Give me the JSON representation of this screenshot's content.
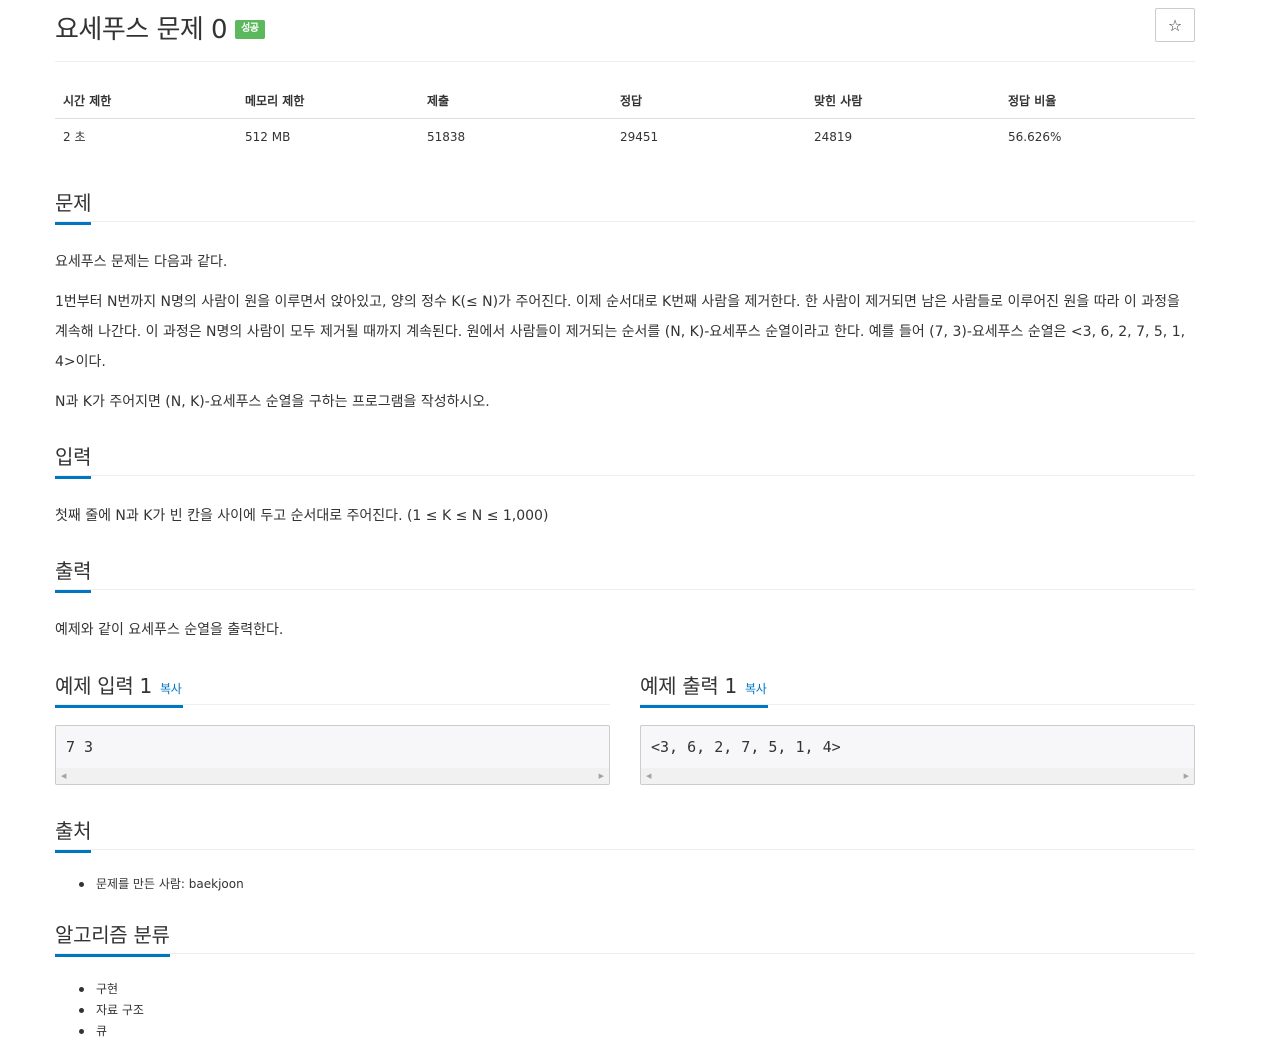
{
  "problem": {
    "title": "요세푸스 문제 0",
    "badge": "성공",
    "star_icon": "☆"
  },
  "stats": {
    "headers": [
      "시간 제한",
      "메모리 제한",
      "제출",
      "정답",
      "맞힌 사람",
      "정답 비율"
    ],
    "values": [
      "2 초",
      "512 MB",
      "51838",
      "29451",
      "24819",
      "56.626%"
    ]
  },
  "sections": {
    "problem": {
      "heading": "문제",
      "paragraphs": [
        "요세푸스 문제는 다음과 같다.",
        "1번부터 N번까지 N명의 사람이 원을 이루면서 앉아있고, 양의 정수 K(≤ N)가 주어진다. 이제 순서대로 K번째 사람을 제거한다. 한 사람이 제거되면 남은 사람들로 이루어진 원을 따라 이 과정을 계속해 나간다. 이 과정은 N명의 사람이 모두 제거될 때까지 계속된다. 원에서 사람들이 제거되는 순서를 (N, K)-요세푸스 순열이라고 한다. 예를 들어 (7, 3)-요세푸스 순열은 <3, 6, 2, 7, 5, 1, 4>이다.",
        "N과 K가 주어지면 (N, K)-요세푸스 순열을 구하는 프로그램을 작성하시오."
      ]
    },
    "input": {
      "heading": "입력",
      "text": "첫째 줄에 N과 K가 빈 칸을 사이에 두고 순서대로 주어진다. (1 ≤ K ≤ N ≤ 1,000)"
    },
    "output": {
      "heading": "출력",
      "text": "예제와 같이 요세푸스 순열을 출력한다."
    },
    "sample_input": {
      "heading": "예제 입력 1",
      "copy": "복사",
      "content": "7 3"
    },
    "sample_output": {
      "heading": "예제 출력 1",
      "copy": "복사",
      "content": "<3, 6, 2, 7, 5, 1, 4>"
    },
    "source": {
      "heading": "출처",
      "items": [
        "문제를 만든 사람: baekjoon"
      ]
    },
    "tags": {
      "heading": "알고리즘 분류",
      "items": [
        "구현",
        "자료 구조",
        "큐"
      ]
    }
  },
  "colors": {
    "accent": "#0076c0",
    "badge_success": "#5cb85c",
    "pre_background": "#f7f7f9"
  }
}
